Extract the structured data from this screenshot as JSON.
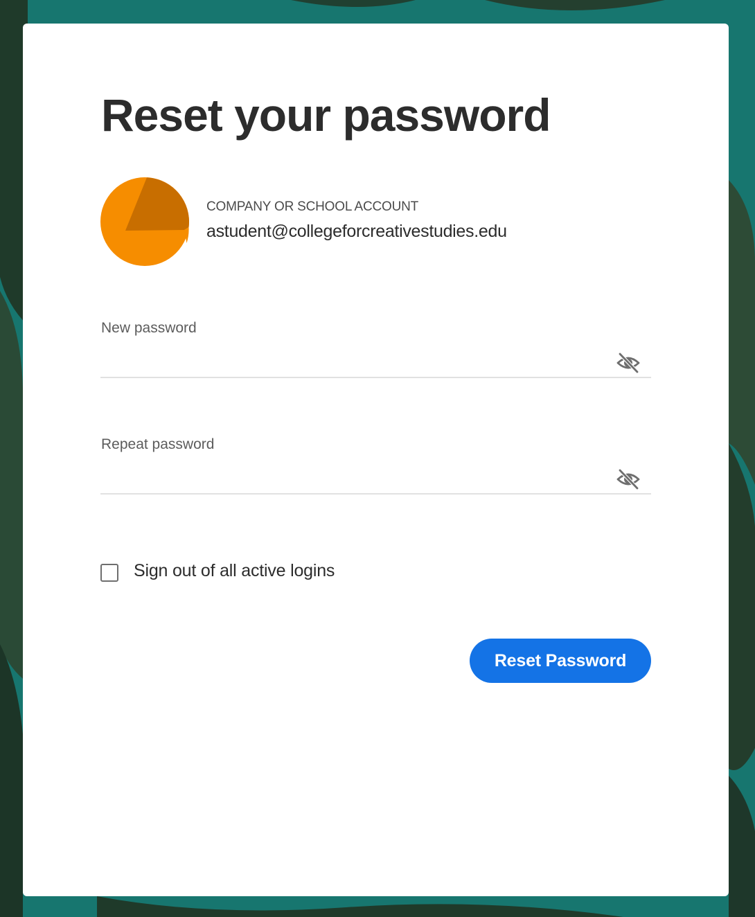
{
  "page": {
    "title": "Reset your password"
  },
  "account": {
    "type_label": "COMPANY OR SCHOOL ACCOUNT",
    "email": "astudent@collegeforcreativestudies.edu",
    "avatar_colors": {
      "base": "#f68d00",
      "shade": "#c86e00"
    }
  },
  "fields": {
    "new_password": {
      "label": "New password",
      "value": "",
      "toggle_icon": "eye-slash-icon"
    },
    "repeat_password": {
      "label": "Repeat password",
      "value": "",
      "toggle_icon": "eye-slash-icon"
    }
  },
  "options": {
    "sign_out_all": {
      "label": "Sign out of all active logins",
      "checked": false
    }
  },
  "actions": {
    "reset_label": "Reset Password"
  },
  "colors": {
    "primary": "#1473e6",
    "background": "#17766f"
  }
}
